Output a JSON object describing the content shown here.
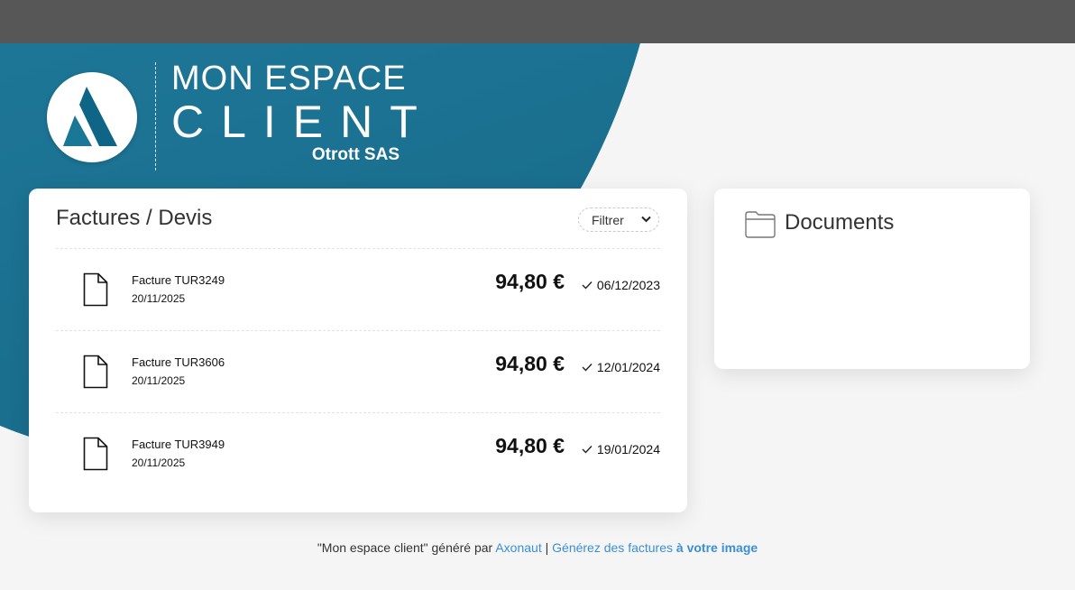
{
  "brand": {
    "line1": "MON ESPACE",
    "line2": "CLIENT",
    "company": "Otrott SAS",
    "logo_icon": "mountain-logo-icon",
    "accent_color": "#207b9c"
  },
  "invoices": {
    "title": "Factures / Devis",
    "filter_label": "Filtrer",
    "rows": [
      {
        "name": "Facture TUR3249",
        "date": "20/11/2025",
        "amount": "94,80 €",
        "paid_date": "06/12/2023"
      },
      {
        "name": "Facture TUR3606",
        "date": "20/11/2025",
        "amount": "94,80 €",
        "paid_date": "12/01/2024"
      },
      {
        "name": "Facture TUR3949",
        "date": "20/11/2025",
        "amount": "94,80 €",
        "paid_date": "19/01/2024"
      }
    ]
  },
  "documents": {
    "title": "Documents",
    "icon": "folder-icon"
  },
  "footer": {
    "prefix": "\"Mon espace client\" généré par",
    "link1": "Axonaut",
    "pipe": "|",
    "link2_text": "Générez des factures",
    "link2_bold": "à votre image",
    "link_color": "#3a8fd6"
  }
}
